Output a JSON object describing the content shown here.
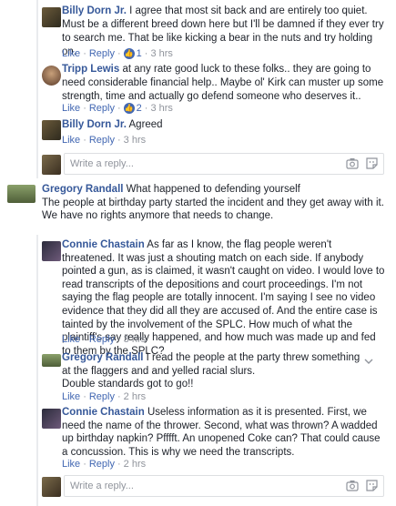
{
  "thread": {
    "action_like": "Like",
    "action_reply": "Reply",
    "separator": "·",
    "reply_placeholder": "Write a reply...",
    "replies_top": [
      {
        "author": "Billy Dorn Jr.",
        "text": "I agree that most sit back and are entirely too quiet. Must be a different breed down here but I'll be damned if they ever try to search me. That be like kicking a bear in the nuts and try holding on.",
        "reaction_count": "1",
        "time": "3 hrs"
      },
      {
        "author": "Tripp Lewis",
        "text": "at any rate good luck to these folks.. they are going to need considerable financial help.. Maybe ol' Kirk can muster up some strength, time and actually go defend someone who deserves it..",
        "reaction_count": "2",
        "time": "3 hrs"
      },
      {
        "author": "Billy Dorn Jr.",
        "text": "Agreed",
        "time": "3 hrs"
      }
    ],
    "main_comment": {
      "author": "Gregory Randall",
      "text_line1": "What happened to defending yourself",
      "text_line2": "The people at birthday party started the incident and they get away with it.",
      "text_line3": "We have no rights anymore that needs to change."
    },
    "replies_bottom": [
      {
        "author": "Connie Chastain",
        "text": "As far as I know, the flag people weren't threatened. It was just a shouting match on each side. If anybody pointed a gun, as is claimed, it wasn't caught on video. I would love to read transcripts of the depositions and court proceedings. I'm not saying the flag people are totally innocent. I'm saying I see no video evidence that they did all they are accused of. And the entire case is tainted by the involvement of the SPLC. How much of what the plaintiff's say really happened, and how much was made up and fed to them by the SPLC?",
        "time": "3 hrs"
      },
      {
        "author": "Gregory Randall",
        "text": "I read the people at the party threw something at the flaggers and and yelled racial slurs.",
        "text2": "Double standards got to go!!",
        "time": "2 hrs"
      },
      {
        "author": "Connie Chastain",
        "text": "Useless information as it is presented. First, we need the name of the thrower. Second, what was thrown? A wadded up birthday napkin? Pfffft. An unopened Coke can? That could cause a concussion. This is why we need the transcripts.",
        "time": "2 hrs"
      }
    ]
  },
  "colors": {
    "link": "#4267b2",
    "name": "#365899",
    "meta": "#90949c",
    "border": "#dddfe2"
  },
  "icons": [
    "camera-icon",
    "sticker-icon",
    "like-reaction-icon",
    "chevron-down-icon"
  ]
}
